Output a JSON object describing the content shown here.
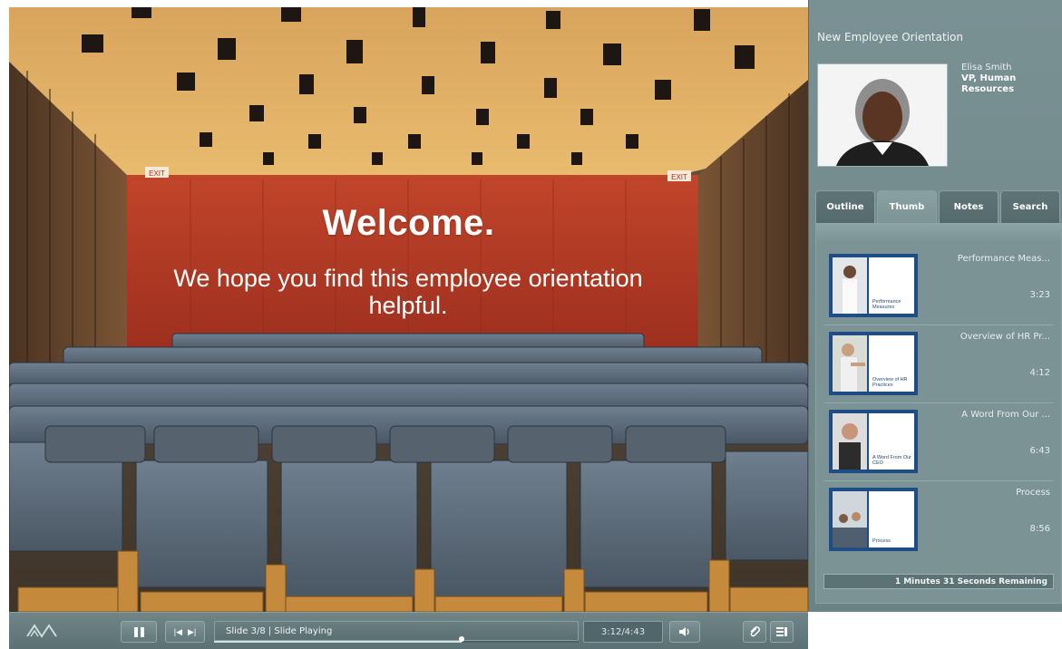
{
  "slide": {
    "title": "Welcome.",
    "subtitle": "We hope you find this employee orientation helpful.",
    "exit_sign_left": "EXIT",
    "exit_sign_right": "EXIT"
  },
  "panel": {
    "presentation_title": "New Employee Orientation",
    "presenter": {
      "name": "Elisa Smith",
      "role": "VP, Human Resources"
    },
    "tabs": [
      {
        "label": "Outline",
        "active": false
      },
      {
        "label": "Thumb",
        "active": true
      },
      {
        "label": "Notes",
        "active": false
      },
      {
        "label": "Search",
        "active": false
      }
    ],
    "slides": [
      {
        "title": "Performance Meas...",
        "time": "3:23",
        "thumb_label": "Performance Measures"
      },
      {
        "title": "Overview of HR Pr...",
        "time": "4:12",
        "thumb_label": "Overview of HR Practices"
      },
      {
        "title": "A Word From Our ...",
        "time": "6:43",
        "thumb_label": "A Word From Our CEO"
      },
      {
        "title": "Process",
        "time": "8:56",
        "thumb_label": "Process"
      }
    ],
    "remaining": "1 Minutes 31 Seconds Remaining"
  },
  "controls": {
    "status": "Slide 3/8  |  Slide Playing",
    "time": "3:12/4:43",
    "progress_fraction": 0.68
  },
  "icons": {
    "logo": "brand-logo-icon",
    "pause": "pause-icon",
    "prev": "skip-back-icon",
    "next": "skip-forward-icon",
    "volume": "volume-icon",
    "attachment": "attachment-icon",
    "menu": "menu-icon"
  },
  "colors": {
    "panel": "#7a9194",
    "thumb_border": "#204d85",
    "slide_wall": "#b33a22"
  }
}
